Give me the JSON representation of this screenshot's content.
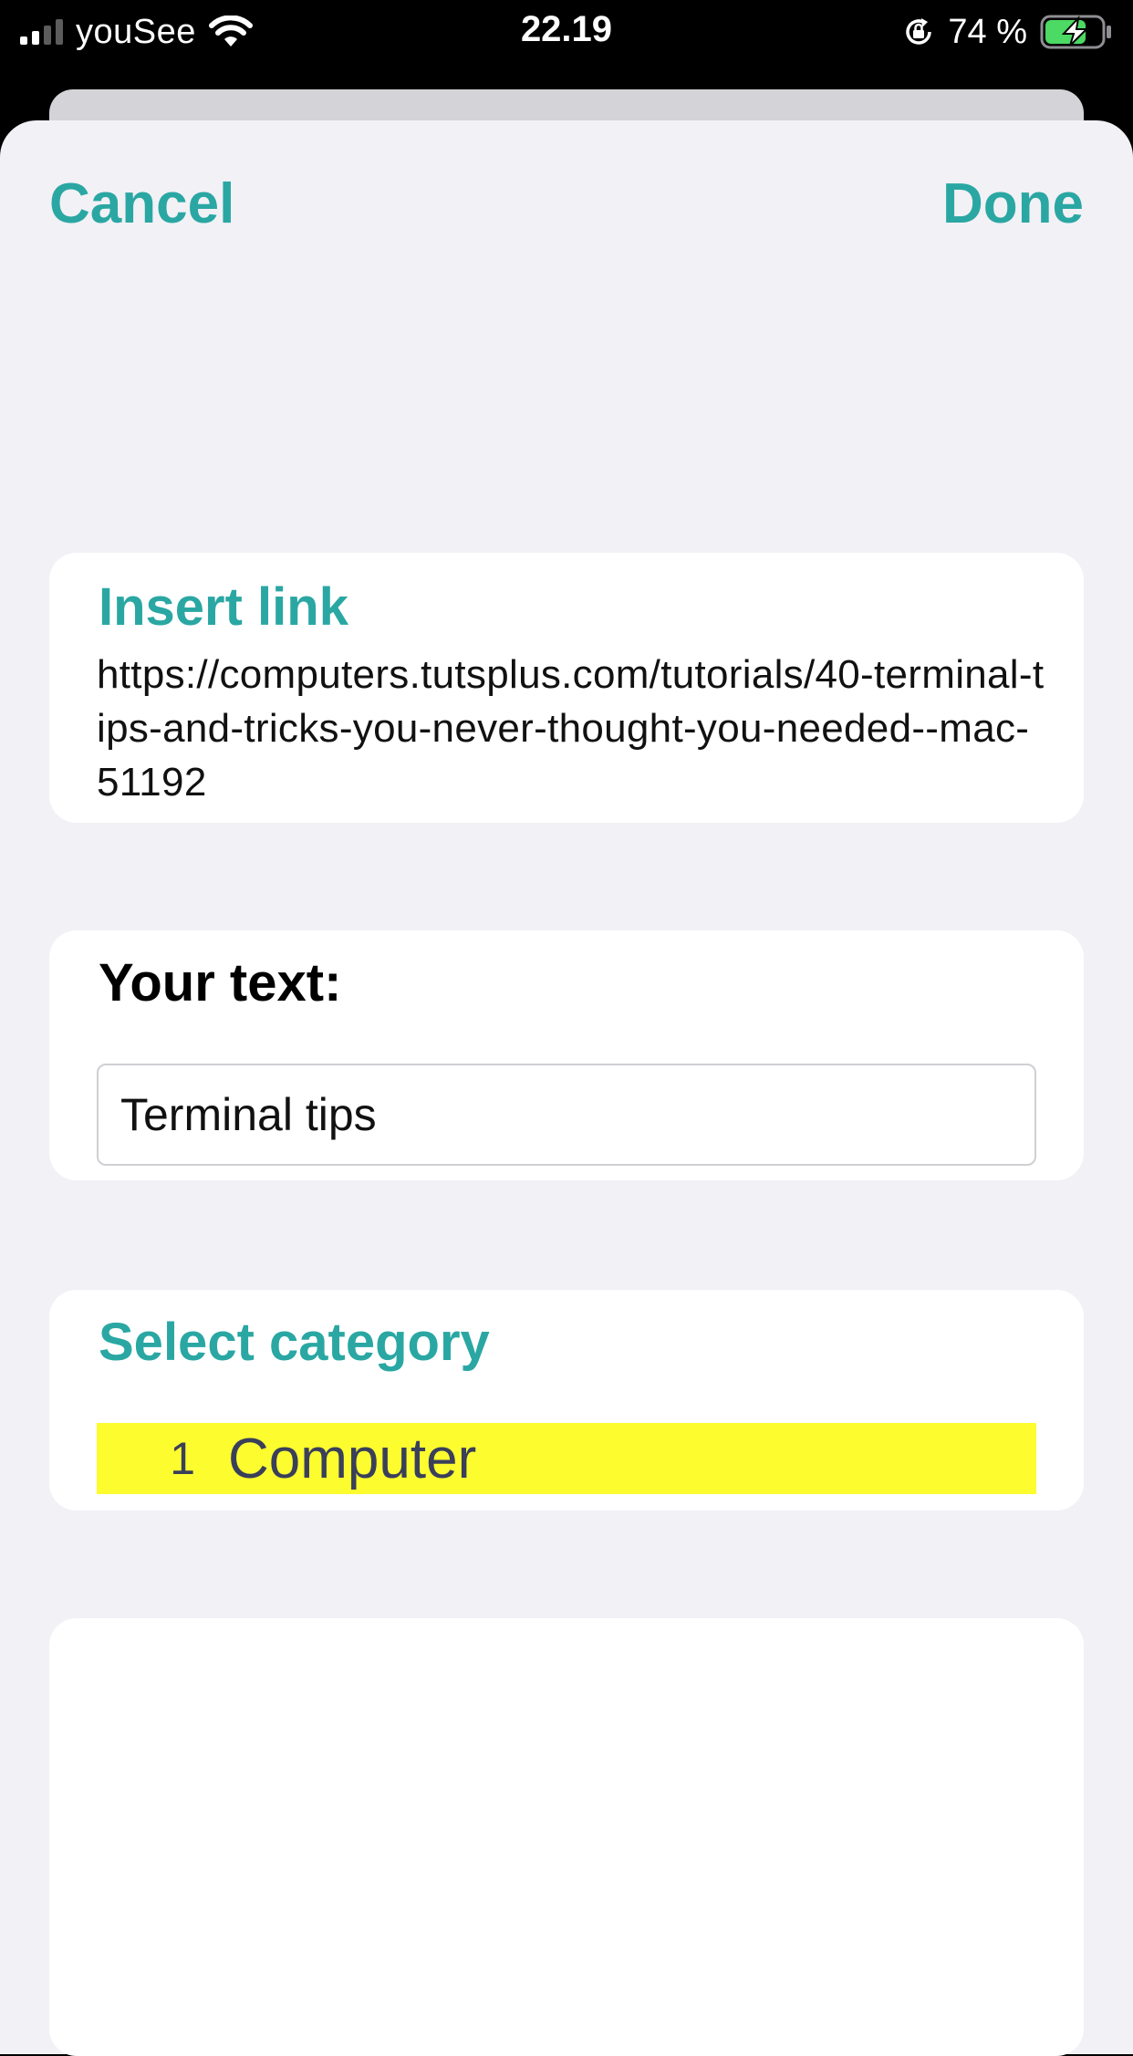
{
  "status_bar": {
    "carrier": "youSee",
    "time": "22.19",
    "battery_percent": "74 %",
    "signal_bars_active": 2,
    "signal_bars_total": 4,
    "battery_level": 0.74,
    "charging": true,
    "icons": [
      "signal-icon",
      "wifi-icon",
      "rotation-lock-icon",
      "battery-charging-icon"
    ]
  },
  "nav": {
    "cancel_label": "Cancel",
    "done_label": "Done"
  },
  "link_section": {
    "title": "Insert link",
    "url": "https://computers.tutsplus.com/tutorials/40-terminal-tips-and-tricks-you-never-thought-you-needed--mac-51192"
  },
  "text_section": {
    "label": "Your text:",
    "value": "Terminal tips"
  },
  "category_section": {
    "title": "Select category",
    "items": [
      {
        "number": "1",
        "name": "Computer",
        "selected": true
      }
    ]
  },
  "colors": {
    "accent": "#2aa7a3",
    "selected_highlight": "#fcfc2f",
    "sheet_background": "#f2f1f6",
    "card_background": "#ffffff"
  }
}
